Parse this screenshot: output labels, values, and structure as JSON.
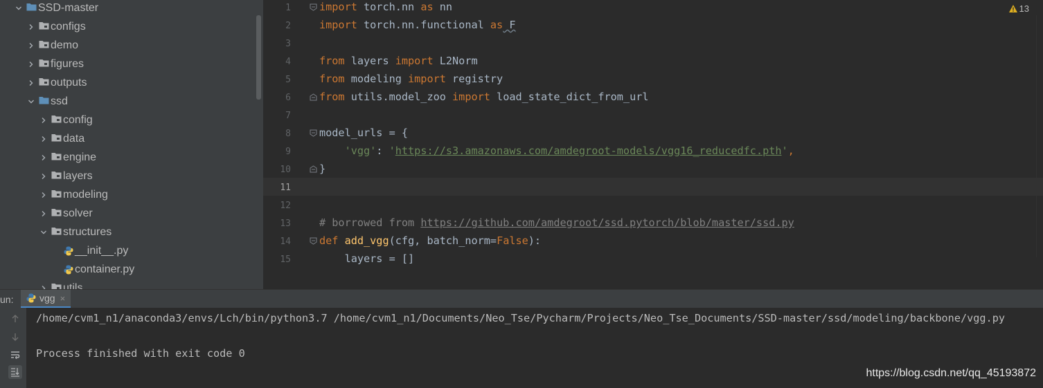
{
  "project_tree": {
    "items": [
      {
        "label": "SSD-master",
        "depth": 0,
        "type": "folder",
        "expanded": true
      },
      {
        "label": "configs",
        "depth": 1,
        "type": "folder",
        "expanded": false
      },
      {
        "label": "demo",
        "depth": 1,
        "type": "folder",
        "expanded": false
      },
      {
        "label": "figures",
        "depth": 1,
        "type": "folder",
        "expanded": false
      },
      {
        "label": "outputs",
        "depth": 1,
        "type": "folder",
        "expanded": false
      },
      {
        "label": "ssd",
        "depth": 1,
        "type": "folder",
        "expanded": true
      },
      {
        "label": "config",
        "depth": 2,
        "type": "folder",
        "expanded": false
      },
      {
        "label": "data",
        "depth": 2,
        "type": "folder",
        "expanded": false
      },
      {
        "label": "engine",
        "depth": 2,
        "type": "folder",
        "expanded": false
      },
      {
        "label": "layers",
        "depth": 2,
        "type": "folder",
        "expanded": false
      },
      {
        "label": "modeling",
        "depth": 2,
        "type": "folder",
        "expanded": false
      },
      {
        "label": "solver",
        "depth": 2,
        "type": "folder",
        "expanded": false
      },
      {
        "label": "structures",
        "depth": 2,
        "type": "folder",
        "expanded": true
      },
      {
        "label": "__init__.py",
        "depth": 3,
        "type": "python-file"
      },
      {
        "label": "container.py",
        "depth": 3,
        "type": "python-file"
      },
      {
        "label": "utils",
        "depth": 2,
        "type": "folder",
        "expanded": false
      }
    ]
  },
  "editor": {
    "warning_count": "13",
    "current_line": "11",
    "line_numbers": [
      "1",
      "2",
      "3",
      "4",
      "5",
      "6",
      "7",
      "8",
      "9",
      "10",
      "11",
      "12",
      "13",
      "14",
      "15"
    ],
    "code": {
      "l1": {
        "kw1": "import",
        "t1": " torch.nn ",
        "kw2": "as",
        "t2": " nn"
      },
      "l2": {
        "kw1": "import",
        "t1": " torch.nn.functional ",
        "kw2": "as",
        "t2": " F"
      },
      "l4": {
        "kw1": "from",
        "t1": " layers ",
        "kw2": "import",
        "t2": " L2Norm"
      },
      "l5": {
        "kw1": "from",
        "t1": " modeling ",
        "kw2": "import",
        "t2": " registry"
      },
      "l6": {
        "kw1": "from",
        "t1": " utils.model_zoo ",
        "kw2": "import",
        "t2": " load_state_dict_from_url"
      },
      "l8": {
        "t1": "model_urls = {"
      },
      "l9": {
        "indent": "    ",
        "s1": "'vgg'",
        "t1": ": ",
        "s2q1": "'",
        "url": "https://s3.amazonaws.com/amdegroot-models/vgg16_reducedfc.pth",
        "s2q2": "'",
        "t2": ","
      },
      "l10": {
        "t1": "}"
      },
      "l13": {
        "c1": "# borrowed from ",
        "url": "https://github.com/amdegroot/ssd.pytorch/blob/master/ssd.py"
      },
      "l14": {
        "kw1": "def",
        "sp": " ",
        "fn": "add_vgg",
        "t1": "(cfg, batch_norm=",
        "kw2": "False",
        "t2": "):"
      },
      "l15": {
        "t1": "    layers = []"
      }
    }
  },
  "run_panel": {
    "label": "un:",
    "tab_name": "vgg",
    "close_glyph": "×",
    "output_lines": [
      "/home/cvm1_n1/anaconda3/envs/Lch/bin/python3.7 /home/cvm1_n1/Documents/Neo_Tse/Pycharm/Projects/Neo_Tse_Documents/SSD-master/ssd/modeling/backbone/vgg.py",
      "",
      "Process finished with exit code 0"
    ],
    "watermark": "https://blog.csdn.net/qq_45193872"
  },
  "colors": {
    "folder": "#5e8fb8",
    "keyword": "#cc7832",
    "string": "#6a8759",
    "function": "#ffc66d",
    "comment": "#808080",
    "warning": "#e0b020"
  }
}
